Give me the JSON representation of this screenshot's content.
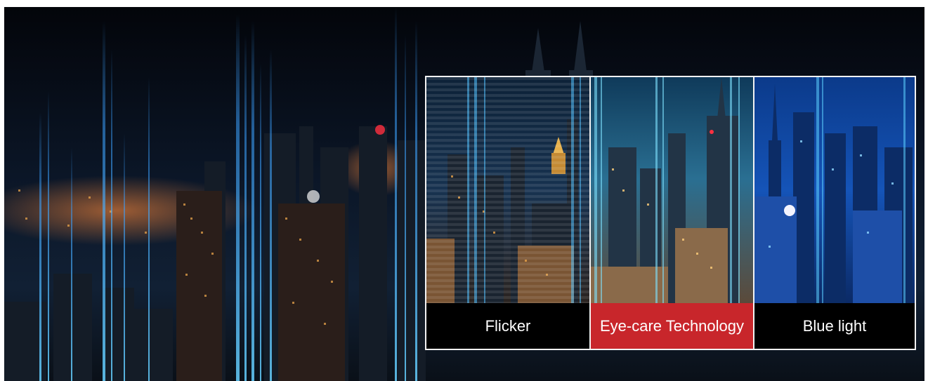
{
  "comparison": {
    "panes": [
      {
        "label": "Flicker",
        "highlighted": false
      },
      {
        "label": "Eye-care Technology",
        "highlighted": true
      },
      {
        "label": "Blue light",
        "highlighted": false
      }
    ],
    "highlight_color": "#c8262b",
    "frame_color": "#f2f2f2"
  }
}
